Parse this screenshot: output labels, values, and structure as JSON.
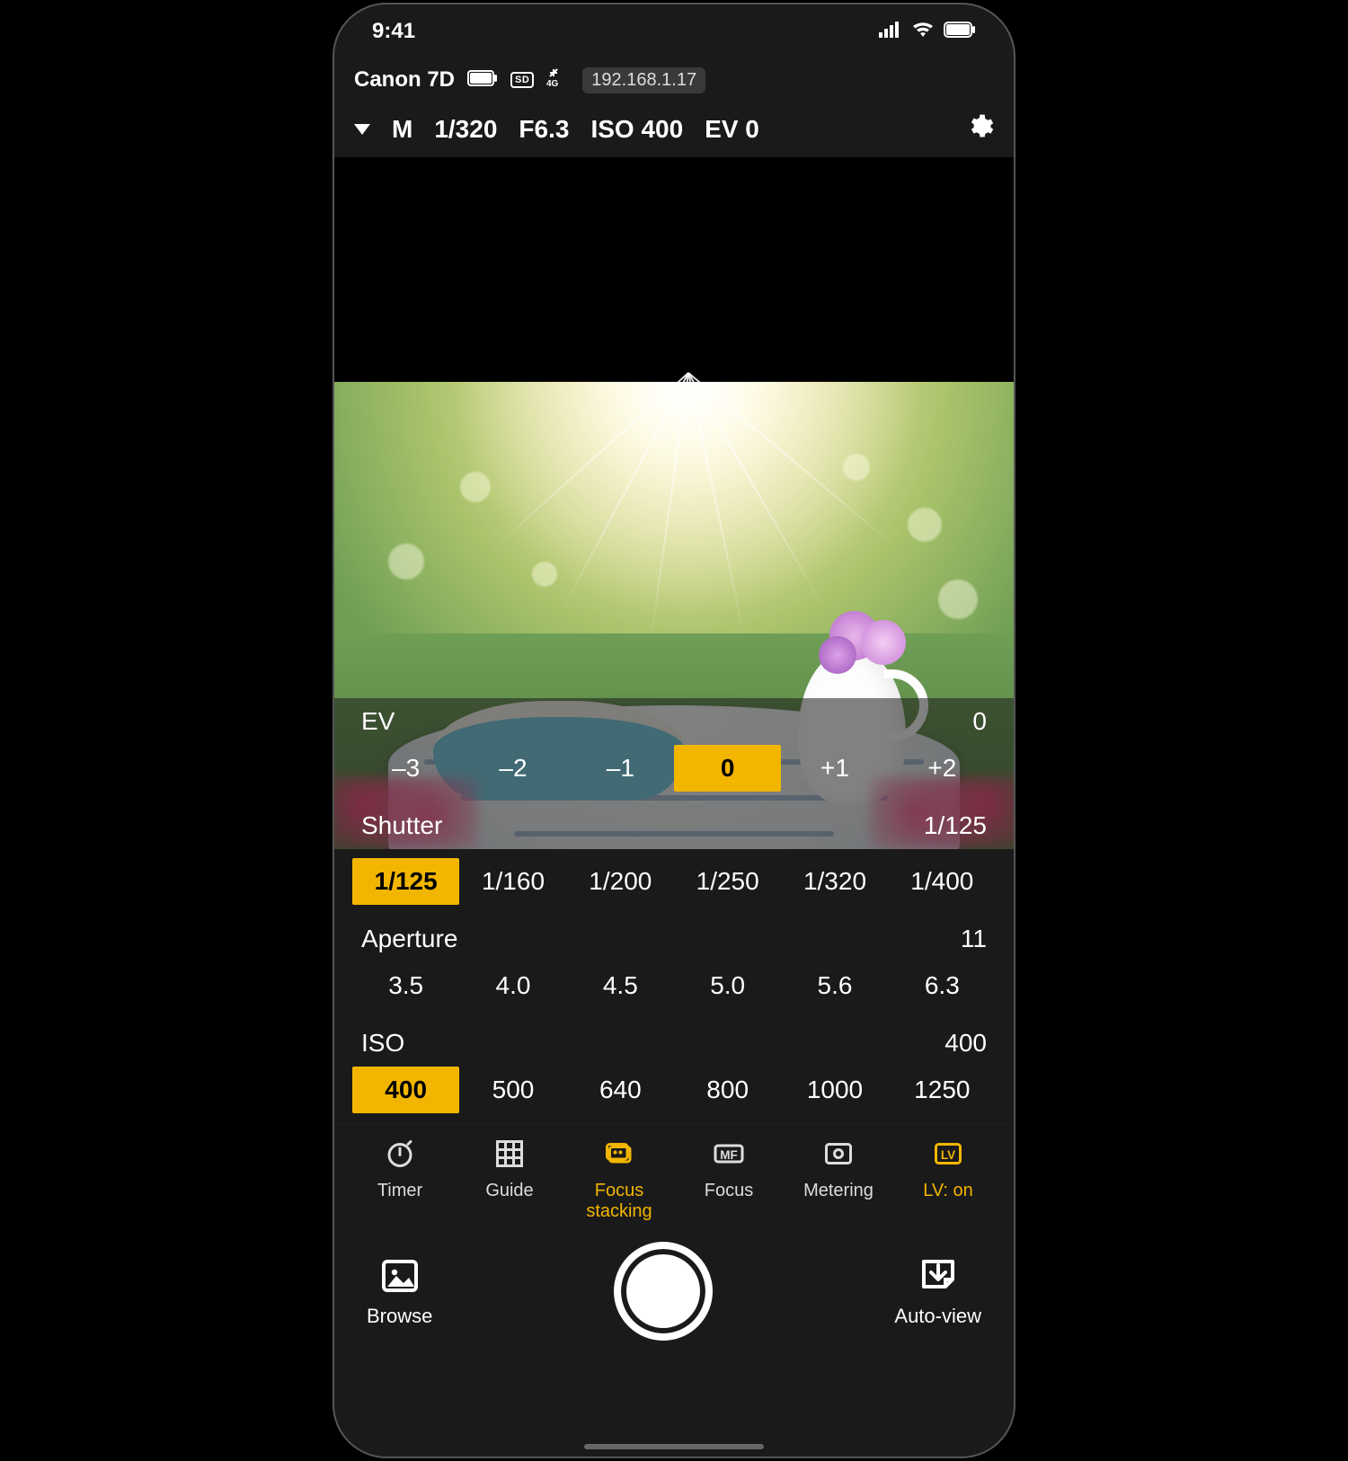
{
  "statusbar": {
    "time": "9:41"
  },
  "camera": {
    "model": "Canon 7D",
    "ip": "192.168.1.17",
    "network_badge": "4G"
  },
  "exposure_bar": {
    "mode": "M",
    "shutter": "1/320",
    "aperture": "F6.3",
    "iso": "ISO 400",
    "ev": "EV 0"
  },
  "controls": {
    "ev": {
      "label": "EV",
      "value": "0",
      "options": [
        "–3",
        "–2",
        "–1",
        "0",
        "+1",
        "+2"
      ],
      "selected_index": 3
    },
    "shutter": {
      "label": "Shutter",
      "value": "1/125",
      "options": [
        "1/125",
        "1/160",
        "1/200",
        "1/250",
        "1/320",
        "1/400"
      ],
      "selected_index": 0
    },
    "aperture": {
      "label": "Aperture",
      "value": "11",
      "options": [
        "3.5",
        "4.0",
        "4.5",
        "5.0",
        "5.6",
        "6.3"
      ],
      "selected_index": -1
    },
    "iso": {
      "label": "ISO",
      "value": "400",
      "options": [
        "400",
        "500",
        "640",
        "800",
        "1000",
        "1250"
      ],
      "selected_index": 0
    }
  },
  "tools": {
    "items": [
      {
        "id": "timer",
        "label": "Timer",
        "icon": "timer-icon",
        "active": false
      },
      {
        "id": "guide",
        "label": "Guide",
        "icon": "grid-icon",
        "active": false
      },
      {
        "id": "focus-stacking",
        "label": "Focus\nstacking",
        "icon": "focus-stacking-icon",
        "active": true
      },
      {
        "id": "focus",
        "label": "Focus",
        "icon": "mf-icon",
        "active": false
      },
      {
        "id": "metering",
        "label": "Metering",
        "icon": "metering-icon",
        "active": false
      },
      {
        "id": "lv",
        "label": "LV: on",
        "icon": "lv-icon",
        "active": true
      }
    ]
  },
  "bottom": {
    "browse": "Browse",
    "autoview": "Auto-view"
  },
  "colors": {
    "accent": "#f2b600"
  }
}
